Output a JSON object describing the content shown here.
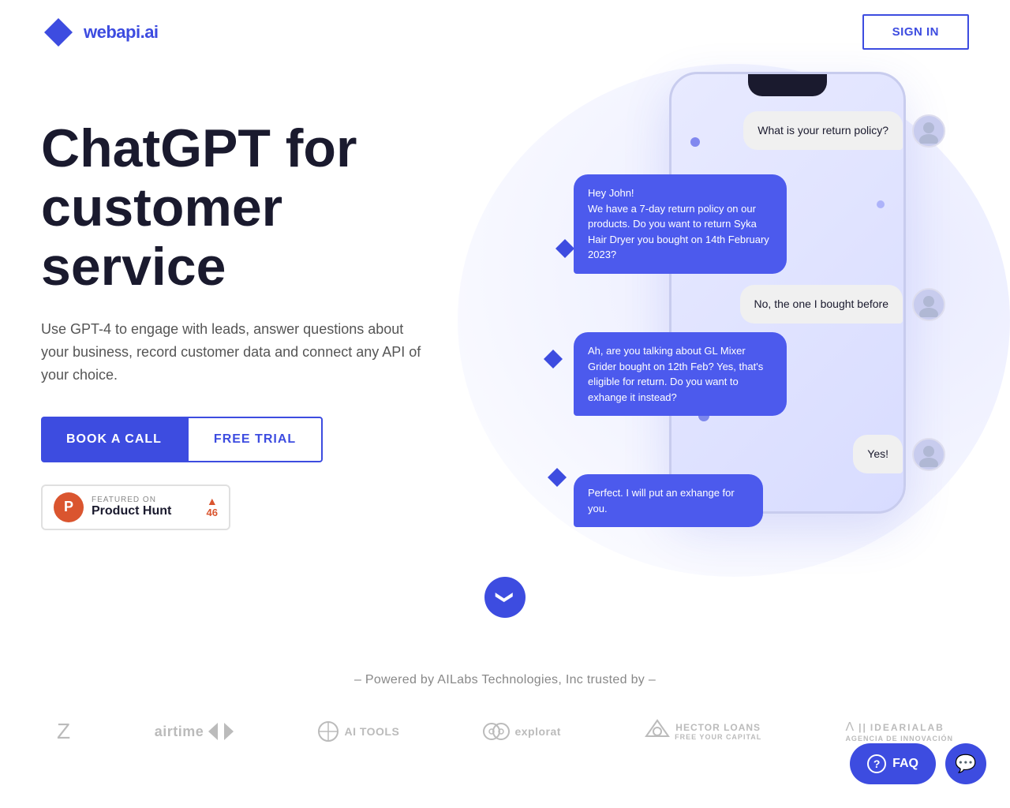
{
  "header": {
    "logo_text_plain": "webapi.",
    "logo_text_accent": "ai",
    "sign_in_label": "SIGN IN"
  },
  "hero": {
    "title_line1": "ChatGPT for",
    "title_line2": "customer service",
    "subtitle": "Use GPT-4 to engage with leads, answer questions about your business, record customer data and connect any API of your choice.",
    "btn_book_label": "BOOK A CALL",
    "btn_trial_label": "FREE TRIAL",
    "ph_featured_label": "FEATURED ON",
    "ph_name": "Product Hunt",
    "ph_votes": "46"
  },
  "chat": {
    "msg1_user": "What is your return policy?",
    "msg2_bot": "Hey John!\nWe have a 7-day return policy on our products. Do you want to return Syka Hair Dryer you bought on 14th February 2023?",
    "msg3_user": "No, the one I bought before",
    "msg4_bot": "Ah, are you talking about GL Mixer Grider bought on 12th Feb? Yes, that's eligible for return. Do you want to exhange it instead?",
    "msg5_user": "Yes!",
    "msg6_bot": "Perfect. I will put an exhange for you."
  },
  "scroll": {
    "arrow": "❯"
  },
  "trusted": {
    "label": "– Powered by AILabs Technologies, Inc trusted by –",
    "brands": [
      {
        "name": "Z",
        "style": "big"
      },
      {
        "name": "airtime ⊳⊲",
        "style": "airtime"
      },
      {
        "name": "⊙ AI TOOLS",
        "style": "aitools"
      },
      {
        "name": "⊙⊙ exploreat",
        "style": "explorat"
      },
      {
        "name": "🦅 HECTOR LOANS FREE YOUR CAPITAL",
        "style": "hector"
      },
      {
        "name": "Λ || IDEARIALAB AGENCIA DE INNOVACIÓN",
        "style": "idearialab"
      }
    ]
  },
  "widgets": {
    "faq_label": "FAQ",
    "faq_icon": "?",
    "chat_icon": "💬"
  }
}
